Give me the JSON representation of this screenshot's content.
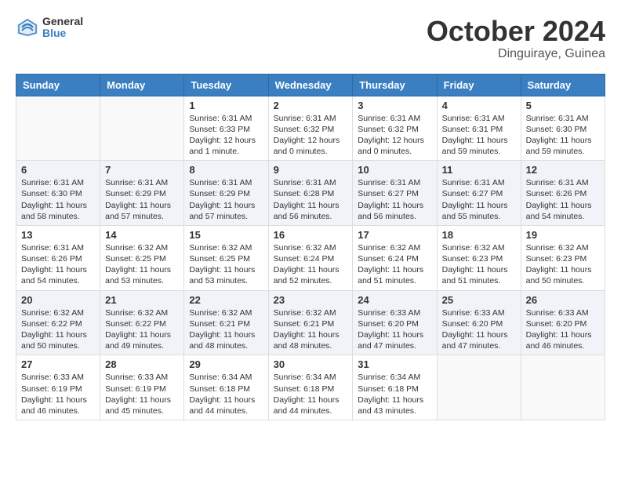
{
  "header": {
    "logo_line1": "General",
    "logo_line2": "Blue",
    "month_title": "October 2024",
    "location": "Dinguiraye, Guinea"
  },
  "weekdays": [
    "Sunday",
    "Monday",
    "Tuesday",
    "Wednesday",
    "Thursday",
    "Friday",
    "Saturday"
  ],
  "weeks": [
    [
      {
        "day": "",
        "text": ""
      },
      {
        "day": "",
        "text": ""
      },
      {
        "day": "1",
        "text": "Sunrise: 6:31 AM\nSunset: 6:33 PM\nDaylight: 12 hours and 1 minute."
      },
      {
        "day": "2",
        "text": "Sunrise: 6:31 AM\nSunset: 6:32 PM\nDaylight: 12 hours and 0 minutes."
      },
      {
        "day": "3",
        "text": "Sunrise: 6:31 AM\nSunset: 6:32 PM\nDaylight: 12 hours and 0 minutes."
      },
      {
        "day": "4",
        "text": "Sunrise: 6:31 AM\nSunset: 6:31 PM\nDaylight: 11 hours and 59 minutes."
      },
      {
        "day": "5",
        "text": "Sunrise: 6:31 AM\nSunset: 6:30 PM\nDaylight: 11 hours and 59 minutes."
      }
    ],
    [
      {
        "day": "6",
        "text": "Sunrise: 6:31 AM\nSunset: 6:30 PM\nDaylight: 11 hours and 58 minutes."
      },
      {
        "day": "7",
        "text": "Sunrise: 6:31 AM\nSunset: 6:29 PM\nDaylight: 11 hours and 57 minutes."
      },
      {
        "day": "8",
        "text": "Sunrise: 6:31 AM\nSunset: 6:29 PM\nDaylight: 11 hours and 57 minutes."
      },
      {
        "day": "9",
        "text": "Sunrise: 6:31 AM\nSunset: 6:28 PM\nDaylight: 11 hours and 56 minutes."
      },
      {
        "day": "10",
        "text": "Sunrise: 6:31 AM\nSunset: 6:27 PM\nDaylight: 11 hours and 56 minutes."
      },
      {
        "day": "11",
        "text": "Sunrise: 6:31 AM\nSunset: 6:27 PM\nDaylight: 11 hours and 55 minutes."
      },
      {
        "day": "12",
        "text": "Sunrise: 6:31 AM\nSunset: 6:26 PM\nDaylight: 11 hours and 54 minutes."
      }
    ],
    [
      {
        "day": "13",
        "text": "Sunrise: 6:31 AM\nSunset: 6:26 PM\nDaylight: 11 hours and 54 minutes."
      },
      {
        "day": "14",
        "text": "Sunrise: 6:32 AM\nSunset: 6:25 PM\nDaylight: 11 hours and 53 minutes."
      },
      {
        "day": "15",
        "text": "Sunrise: 6:32 AM\nSunset: 6:25 PM\nDaylight: 11 hours and 53 minutes."
      },
      {
        "day": "16",
        "text": "Sunrise: 6:32 AM\nSunset: 6:24 PM\nDaylight: 11 hours and 52 minutes."
      },
      {
        "day": "17",
        "text": "Sunrise: 6:32 AM\nSunset: 6:24 PM\nDaylight: 11 hours and 51 minutes."
      },
      {
        "day": "18",
        "text": "Sunrise: 6:32 AM\nSunset: 6:23 PM\nDaylight: 11 hours and 51 minutes."
      },
      {
        "day": "19",
        "text": "Sunrise: 6:32 AM\nSunset: 6:23 PM\nDaylight: 11 hours and 50 minutes."
      }
    ],
    [
      {
        "day": "20",
        "text": "Sunrise: 6:32 AM\nSunset: 6:22 PM\nDaylight: 11 hours and 50 minutes."
      },
      {
        "day": "21",
        "text": "Sunrise: 6:32 AM\nSunset: 6:22 PM\nDaylight: 11 hours and 49 minutes."
      },
      {
        "day": "22",
        "text": "Sunrise: 6:32 AM\nSunset: 6:21 PM\nDaylight: 11 hours and 48 minutes."
      },
      {
        "day": "23",
        "text": "Sunrise: 6:32 AM\nSunset: 6:21 PM\nDaylight: 11 hours and 48 minutes."
      },
      {
        "day": "24",
        "text": "Sunrise: 6:33 AM\nSunset: 6:20 PM\nDaylight: 11 hours and 47 minutes."
      },
      {
        "day": "25",
        "text": "Sunrise: 6:33 AM\nSunset: 6:20 PM\nDaylight: 11 hours and 47 minutes."
      },
      {
        "day": "26",
        "text": "Sunrise: 6:33 AM\nSunset: 6:20 PM\nDaylight: 11 hours and 46 minutes."
      }
    ],
    [
      {
        "day": "27",
        "text": "Sunrise: 6:33 AM\nSunset: 6:19 PM\nDaylight: 11 hours and 46 minutes."
      },
      {
        "day": "28",
        "text": "Sunrise: 6:33 AM\nSunset: 6:19 PM\nDaylight: 11 hours and 45 minutes."
      },
      {
        "day": "29",
        "text": "Sunrise: 6:34 AM\nSunset: 6:18 PM\nDaylight: 11 hours and 44 minutes."
      },
      {
        "day": "30",
        "text": "Sunrise: 6:34 AM\nSunset: 6:18 PM\nDaylight: 11 hours and 44 minutes."
      },
      {
        "day": "31",
        "text": "Sunrise: 6:34 AM\nSunset: 6:18 PM\nDaylight: 11 hours and 43 minutes."
      },
      {
        "day": "",
        "text": ""
      },
      {
        "day": "",
        "text": ""
      }
    ]
  ]
}
